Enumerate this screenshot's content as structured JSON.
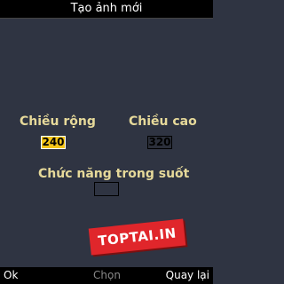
{
  "title": "Tạo ảnh mới",
  "form": {
    "width_label": "Chiều rộng",
    "width_value": "240",
    "height_label": "Chiều cao",
    "height_value": "320",
    "transparency_label": "Chức năng trong suốt",
    "transparency_checked": false
  },
  "softkeys": {
    "left": "Ok",
    "middle": "Chọn",
    "right": "Quay lại"
  },
  "watermark": "TOPTAI.IN",
  "colors": {
    "background": "#2f3442",
    "label": "#e6d99a",
    "focus": "#f5c518",
    "watermark": "#e0262b"
  }
}
